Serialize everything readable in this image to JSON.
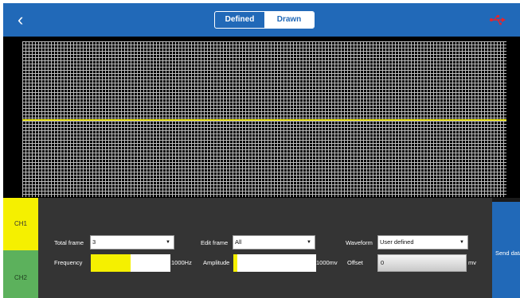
{
  "header": {
    "back_icon": "‹",
    "tabs": [
      {
        "label": "Defined",
        "active": false
      },
      {
        "label": "Drawn",
        "active": true
      }
    ],
    "usb_icon": "usb-icon"
  },
  "channels": [
    {
      "label": "CH1",
      "color": "#f5f000",
      "active": true
    },
    {
      "label": "CH2",
      "color": "#5cb15c",
      "active": false
    }
  ],
  "controls": {
    "total_frame": {
      "label": "Total frame",
      "value": "3"
    },
    "edit_frame": {
      "label": "Edit frame",
      "value": "All"
    },
    "waveform": {
      "label": "Waveform",
      "value": "User defined"
    },
    "frequency": {
      "label": "Frequency",
      "unit": "1000Hz",
      "level": 0.5
    },
    "amplitude": {
      "label": "Amplitude",
      "unit": "1000mv",
      "level": 0.05
    },
    "offset": {
      "label": "Offset",
      "value": "0",
      "unit": "mv"
    }
  },
  "send_button": {
    "label": "Send data"
  },
  "colors": {
    "header": "#2169b8",
    "trace": "#e8e010",
    "ch1": "#f5f000",
    "ch2": "#5cb15c",
    "panel": "#343434"
  }
}
